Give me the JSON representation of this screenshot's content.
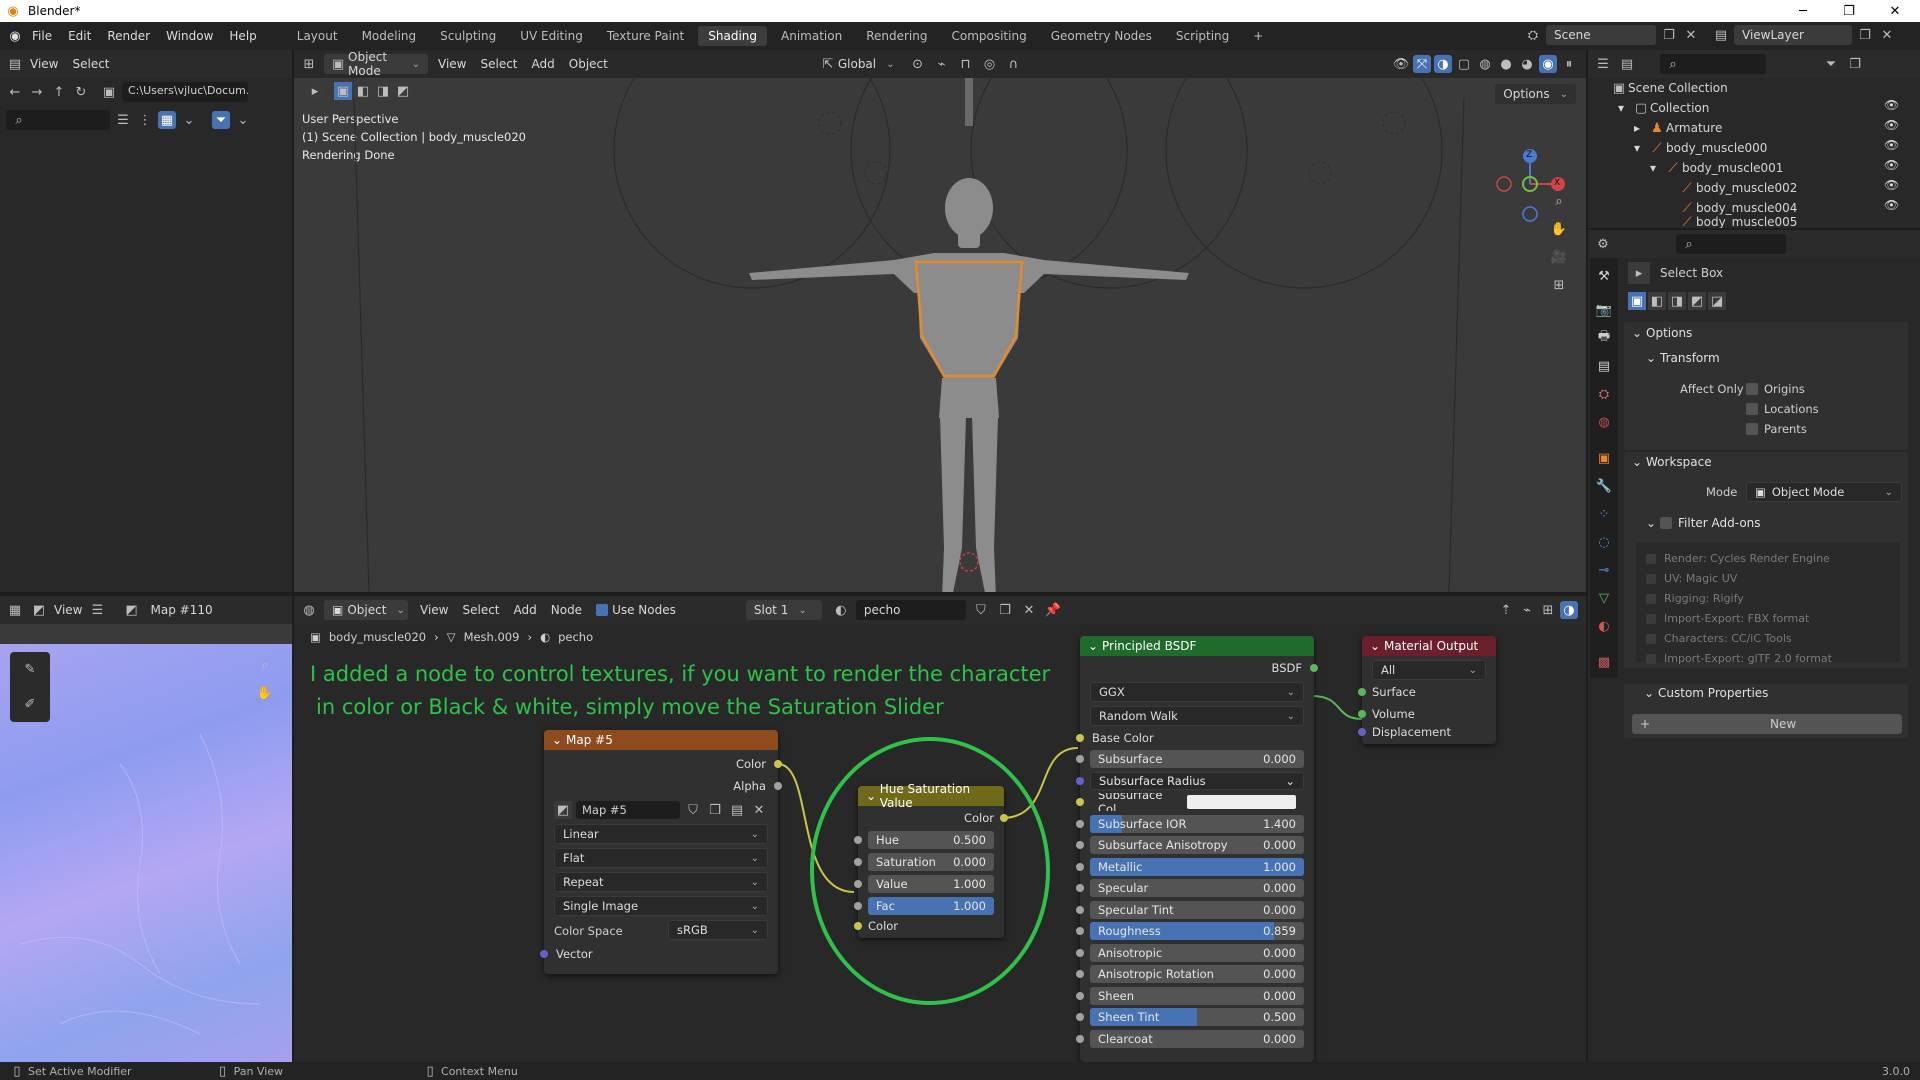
{
  "window": {
    "title": "Blender*",
    "minimize": "─",
    "maximize": "❐",
    "close": "✕"
  },
  "menu": {
    "items": [
      "File",
      "Edit",
      "Render",
      "Window",
      "Help"
    ]
  },
  "workspaces": {
    "tabs": [
      "Layout",
      "Modeling",
      "Sculpting",
      "UV Editing",
      "Texture Paint",
      "Shading",
      "Animation",
      "Rendering",
      "Compositing",
      "Geometry Nodes",
      "Scripting"
    ],
    "active": "Shading",
    "add": "+"
  },
  "scene": {
    "name": "Scene",
    "view_layer": "ViewLayer"
  },
  "file_browser": {
    "menu_view": "View",
    "menu_select": "Select",
    "path": "C:\\Users\\vjluc\\Docum..."
  },
  "viewport": {
    "mode": "Object Mode",
    "menus": [
      "View",
      "Select",
      "Add",
      "Object"
    ],
    "orientation": "Global",
    "options_label": "Options",
    "info_lines": [
      "User Perspective",
      "(1) Scene Collection | body_muscle020",
      "Rendering Done"
    ],
    "gizmo": {
      "z": "Z",
      "x": "X"
    }
  },
  "image_editor": {
    "menu_view": "View",
    "image_name": "Map #110"
  },
  "node_editor": {
    "editor_type": "Object",
    "menus": [
      "View",
      "Select",
      "Add",
      "Node"
    ],
    "use_nodes_label": "Use Nodes",
    "use_nodes": true,
    "slot": "Slot 1",
    "material": "pecho",
    "breadcrumb": [
      "body_muscle020",
      "Mesh.009",
      "pecho"
    ],
    "annotation_line1": "I added a node to control textures, if you want to render the character",
    "annotation_line2": "in color or Black & white, simply move the Saturation Slider",
    "annotation_color": "#2ec24a",
    "image_node": {
      "title": "Map #5",
      "header_color": "#8f4a1e",
      "out_color": "Color",
      "out_alpha": "Alpha",
      "image_name": "Map #5",
      "interpolation": "Linear",
      "projection": "Flat",
      "extension": "Repeat",
      "source": "Single Image",
      "color_space_label": "Color Space",
      "color_space": "sRGB",
      "in_vector": "Vector"
    },
    "hsv_node": {
      "title": "Hue Saturation Value",
      "header_color": "#6e6a1a",
      "out_color": "Color",
      "hue_label": "Hue",
      "hue": "0.500",
      "sat_label": "Saturation",
      "sat": "0.000",
      "val_label": "Value",
      "val": "1.000",
      "fac_label": "Fac",
      "fac": "1.000",
      "in_color": "Color"
    },
    "bsdf_node": {
      "title": "Principled BSDF",
      "header_color": "#1f6b2c",
      "out": "BSDF",
      "distribution": "GGX",
      "subsurface_method": "Random Walk",
      "base_color": "Base Color",
      "rows": [
        {
          "label": "Subsurface",
          "value": "0.000",
          "fill": 0
        },
        {
          "label": "Subsurface Radius",
          "value": "",
          "fill": 0
        },
        {
          "label": "Subsurface Col...",
          "value": "",
          "fill": 0
        },
        {
          "label": "Subsurface IOR",
          "value": "1.400",
          "fill": 0.15
        },
        {
          "label": "Subsurface Anisotropy",
          "value": "0.000",
          "fill": 0
        },
        {
          "label": "Metallic",
          "value": "1.000",
          "fill": 1
        },
        {
          "label": "Specular",
          "value": "0.000",
          "fill": 0
        },
        {
          "label": "Specular Tint",
          "value": "0.000",
          "fill": 0
        },
        {
          "label": "Roughness",
          "value": "0.859",
          "fill": 0.859
        },
        {
          "label": "Anisotropic",
          "value": "0.000",
          "fill": 0
        },
        {
          "label": "Anisotropic Rotation",
          "value": "0.000",
          "fill": 0
        },
        {
          "label": "Sheen",
          "value": "0.000",
          "fill": 0
        },
        {
          "label": "Sheen Tint",
          "value": "0.500",
          "fill": 0.5
        },
        {
          "label": "Clearcoat",
          "value": "0.000",
          "fill": 0
        }
      ]
    },
    "output_node": {
      "title": "Material Output",
      "header_color": "#6b1f2a",
      "target": "All",
      "inputs": [
        "Surface",
        "Volume",
        "Displacement"
      ]
    }
  },
  "outliner": {
    "root": "Scene Collection",
    "items": [
      {
        "label": "Collection",
        "depth": 0
      },
      {
        "label": "Armature",
        "depth": 1
      },
      {
        "label": "body_muscle000",
        "depth": 1
      },
      {
        "label": "body_muscle001",
        "depth": 2
      },
      {
        "label": "body_muscle002",
        "depth": 3
      },
      {
        "label": "body_muscle004",
        "depth": 3
      },
      {
        "label": "body_muscle005",
        "depth": 3
      }
    ]
  },
  "properties": {
    "tool_name": "Select Box",
    "options": "Options",
    "transform": "Transform",
    "affect_only": "Affect Only",
    "affect_items": [
      "Origins",
      "Locations",
      "Parents"
    ],
    "workspace": "Workspace",
    "mode_label": "Mode",
    "mode": "Object Mode",
    "filter_addons": "Filter Add-ons",
    "addons": [
      "Render: Cycles Render Engine",
      "UV: Magic UV",
      "Rigging: Rigify",
      "Import-Export: FBX format",
      "Characters: CC/iC Tools",
      "Import-Export: glTF 2.0 format"
    ],
    "custom_properties": "Custom Properties",
    "new_label": "New"
  },
  "status": {
    "left": "Set Active Modifier",
    "middle": "Pan View",
    "right": "Context Menu",
    "version": "3.0.0"
  }
}
